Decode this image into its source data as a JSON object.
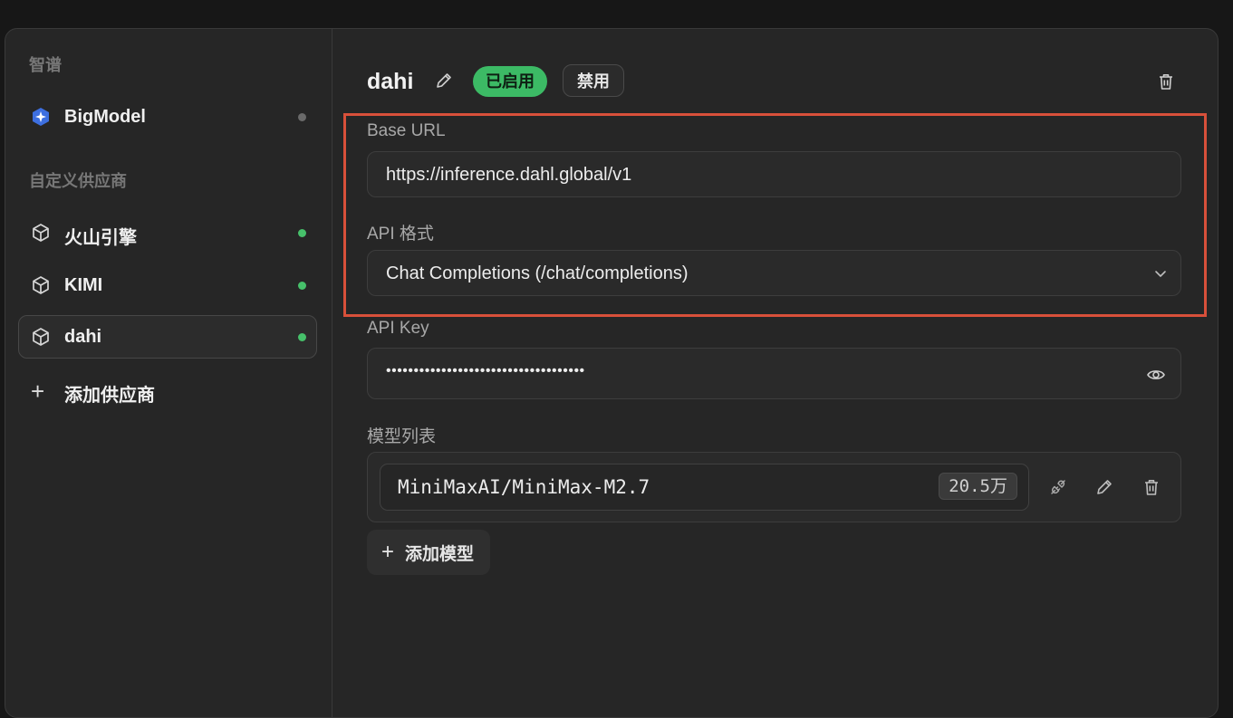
{
  "sidebar": {
    "section_zhipu": "智谱",
    "bigmodel_label": "BigModel",
    "section_custom": "自定义供应商",
    "items": [
      {
        "label": "火山引擎"
      },
      {
        "label": "KIMI"
      },
      {
        "label": "dahi"
      }
    ],
    "add_provider_label": "添加供应商"
  },
  "provider": {
    "name": "dahi",
    "enabled_badge": "已启用",
    "disable_button": "禁用"
  },
  "form": {
    "base_url_label": "Base URL",
    "base_url_value": "https://inference.dahl.global/v1",
    "api_format_label": "API 格式",
    "api_format_value": "Chat Completions (/chat/completions)",
    "api_key_label": "API Key",
    "api_key_value": "••••••••••••••••••••••••••••••••••••",
    "models_label": "模型列表"
  },
  "models": [
    {
      "name": "MiniMaxAI/MiniMax-M2.7",
      "context": "20.5万"
    }
  ],
  "add_model_label": "添加模型",
  "colors": {
    "accent_green": "#3cba65",
    "highlight_red": "#d8503a",
    "background": "#262626"
  }
}
